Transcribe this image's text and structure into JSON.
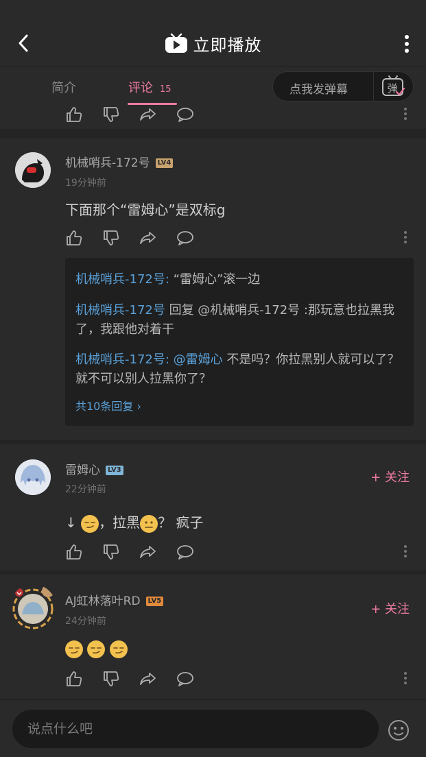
{
  "header": {
    "title": "立即播放",
    "title_icon": "tv-play-icon"
  },
  "tabs": {
    "intro_label": "简介",
    "comments_label": "评论",
    "comments_count": "15",
    "danmaku_label": "点我发弹幕",
    "danmaku_icon_text": "弹"
  },
  "comments": [
    {
      "username": "机械哨兵-172号",
      "level": "LV4",
      "time": "19分钟前",
      "content": "下面那个“雷姆心”是双标g",
      "replies": [
        {
          "user": "机械哨兵-172号",
          "sep": ": ",
          "text": "“雷姆心”滚一边"
        },
        {
          "user": "机械哨兵-172号",
          "sep": " 回复 @机械哨兵-172号 :",
          "text": "那玩意也拉黑我了，我跟他对着干"
        },
        {
          "user": "机械哨兵-172号",
          "sep": ": ",
          "mention": "@雷姆心",
          "text": " 不是吗？你拉黑别人就可以了？就不可以别人拉黑你了？"
        }
      ],
      "reply_more": "共10条回复 ›"
    },
    {
      "username": "雷姆心",
      "level": "LV3",
      "time": "22分钟前",
      "content_pre": "↓",
      "content_mid": "，拉黑",
      "content_post": "？ 疯子",
      "follow": "+ 关注"
    },
    {
      "username": "AJ虹林落叶RD",
      "level": "LV5",
      "time": "24分钟前",
      "follow": "+ 关注"
    }
  ],
  "composer": {
    "placeholder": "说点什么吧"
  },
  "colors": {
    "accent": "#f07ba0",
    "link": "#5aa0d8",
    "background": "#2a2a2a"
  }
}
